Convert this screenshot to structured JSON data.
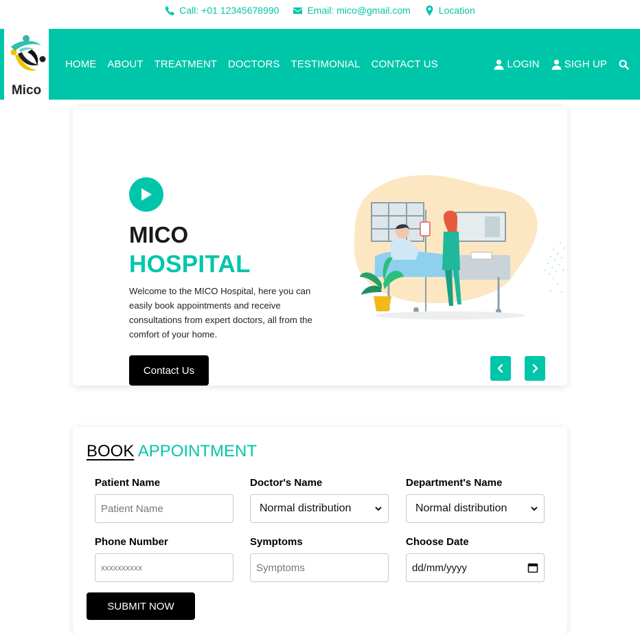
{
  "topbar": {
    "call": "Call: +01 12345678990",
    "email": "Email: mico@gmail.com",
    "location": "Location"
  },
  "brand": {
    "name": "Mico"
  },
  "nav": {
    "items": [
      "HOME",
      "ABOUT",
      "TREATMENT",
      "DOCTORS",
      "TESTIMONIAL",
      "CONTACT US"
    ]
  },
  "auth": {
    "login": "LOGIN",
    "signup": "SIGH UP"
  },
  "hero": {
    "title_line1": "MICO",
    "title_line2": "HOSPITAL",
    "description": "Welcome to the MICO Hospital, here you can easily book appointments and receive consultations from expert doctors, all from the comfort of your home.",
    "button": "Contact Us"
  },
  "booking": {
    "title_part1": "BOOK",
    "title_part2": "APPOINTMENT",
    "fields": {
      "patient_name": {
        "label": "Patient Name",
        "placeholder": "Patient Name"
      },
      "doctor_name": {
        "label": "Doctor's Name",
        "value": "Normal distribution"
      },
      "department": {
        "label": "Department's Name",
        "value": "Normal distribution"
      },
      "phone": {
        "label": "Phone Number",
        "placeholder": "xxxxxxxxxx"
      },
      "symptoms": {
        "label": "Symptoms",
        "placeholder": "Symptoms"
      },
      "date": {
        "label": "Choose Date",
        "placeholder": "dd/mm/yyyy"
      }
    },
    "submit": "SUBMIT NOW"
  },
  "colors": {
    "accent": "#00c6a9",
    "dark": "#000000"
  }
}
